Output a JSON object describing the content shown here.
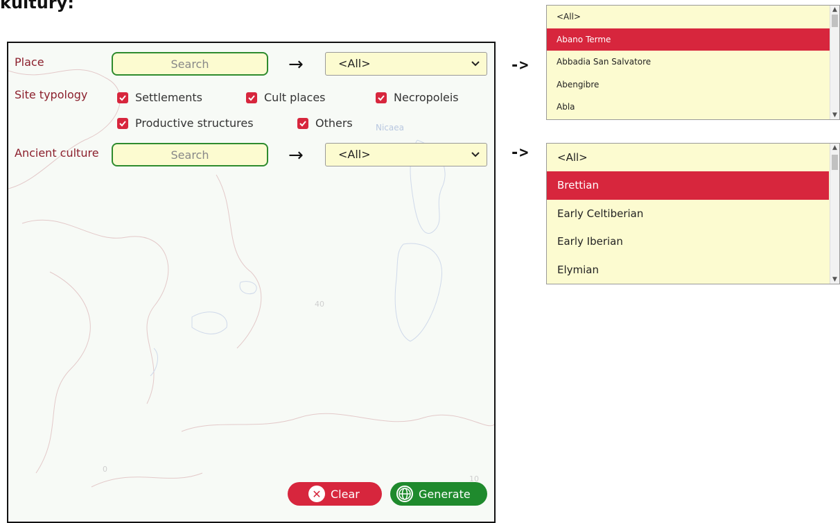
{
  "heading": "kultury:",
  "form": {
    "place": {
      "label": "Place",
      "search_placeholder": "Search",
      "select_value": "<All>"
    },
    "site_typology": {
      "label": "Site typology",
      "options": [
        {
          "label": "Settlements",
          "checked": true
        },
        {
          "label": "Cult places",
          "checked": true
        },
        {
          "label": "Necropoleis",
          "checked": true
        },
        {
          "label": "Productive structures",
          "checked": true
        },
        {
          "label": "Others",
          "checked": true
        }
      ]
    },
    "ancient_culture": {
      "label": "Ancient culture",
      "search_placeholder": "Search",
      "select_value": "<All>"
    },
    "arrow": "→",
    "clear_label": "Clear",
    "generate_label": "Generate"
  },
  "map_labels": [
    "Nicaea",
    "40",
    "0",
    "10"
  ],
  "pointer_text": "->",
  "place_list": {
    "items": [
      "<All>",
      "Abano Terme",
      "Abbadia San Salvatore",
      "Abengibre",
      "Abla"
    ],
    "selected": "Abano Terme"
  },
  "culture_list": {
    "items": [
      "<All>",
      "Brettian",
      "Early Celtiberian",
      "Early Iberian",
      "Elymian"
    ],
    "selected": "Brettian"
  },
  "colors": {
    "accent_red": "#d7263d",
    "accent_green": "#1f8a2d",
    "field_bg": "#fcfbd0",
    "label_color": "#8b1f2c"
  },
  "icons": {
    "arrow": "right-arrow-icon",
    "dropdown": "chevron-down-icon",
    "clear": "x-circle-icon",
    "generate": "globe-icon"
  }
}
